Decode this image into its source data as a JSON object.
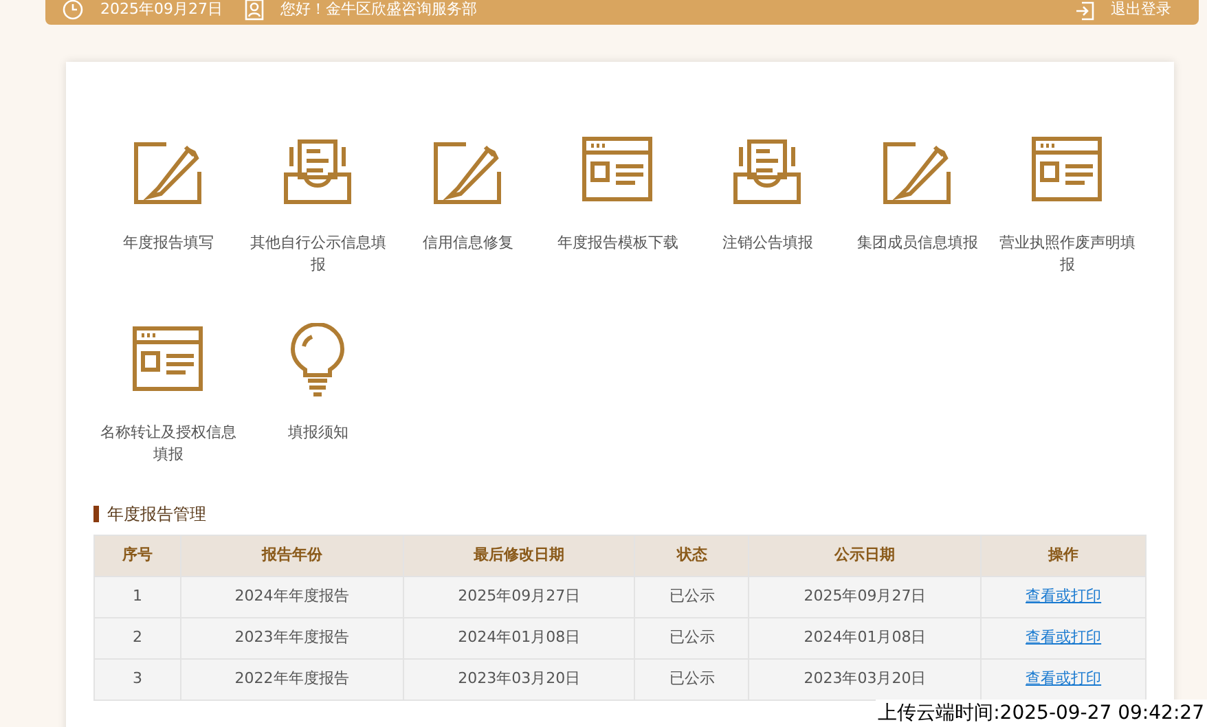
{
  "header": {
    "date": "2025年09月27日",
    "greeting": "您好！金牛区欣盛咨询服务部",
    "logout": "退出登录"
  },
  "services": [
    {
      "kind": "pencil",
      "label": "年度报告填写"
    },
    {
      "kind": "tray",
      "label": "其他自行公示信息填报"
    },
    {
      "kind": "pencil",
      "label": "信用信息修复"
    },
    {
      "kind": "window",
      "label": "年度报告模板下载"
    },
    {
      "kind": "tray",
      "label": "注销公告填报"
    },
    {
      "kind": "pencil",
      "label": "集团成员信息填报"
    },
    {
      "kind": "window",
      "label": "营业执照作废声明填报"
    },
    {
      "kind": "window",
      "label": "名称转让及授权信息填报"
    },
    {
      "kind": "bulb",
      "label": "填报须知"
    }
  ],
  "section_title": "年度报告管理",
  "table": {
    "columns": [
      "序号",
      "报告年份",
      "最后修改日期",
      "状态",
      "公示日期",
      "操作"
    ],
    "rows": [
      [
        "1",
        "2024年年度报告",
        "2025年09月27日",
        "已公示",
        "2025年09月27日",
        "查看或打印"
      ],
      [
        "2",
        "2023年年度报告",
        "2024年01月08日",
        "已公示",
        "2024年01月08日",
        "查看或打印"
      ],
      [
        "3",
        "2022年年度报告",
        "2023年03月20日",
        "已公示",
        "2023年03月20日",
        "查看或打印"
      ]
    ]
  },
  "upload_time": "上传云端时间:2025-09-27 09:42:27"
}
